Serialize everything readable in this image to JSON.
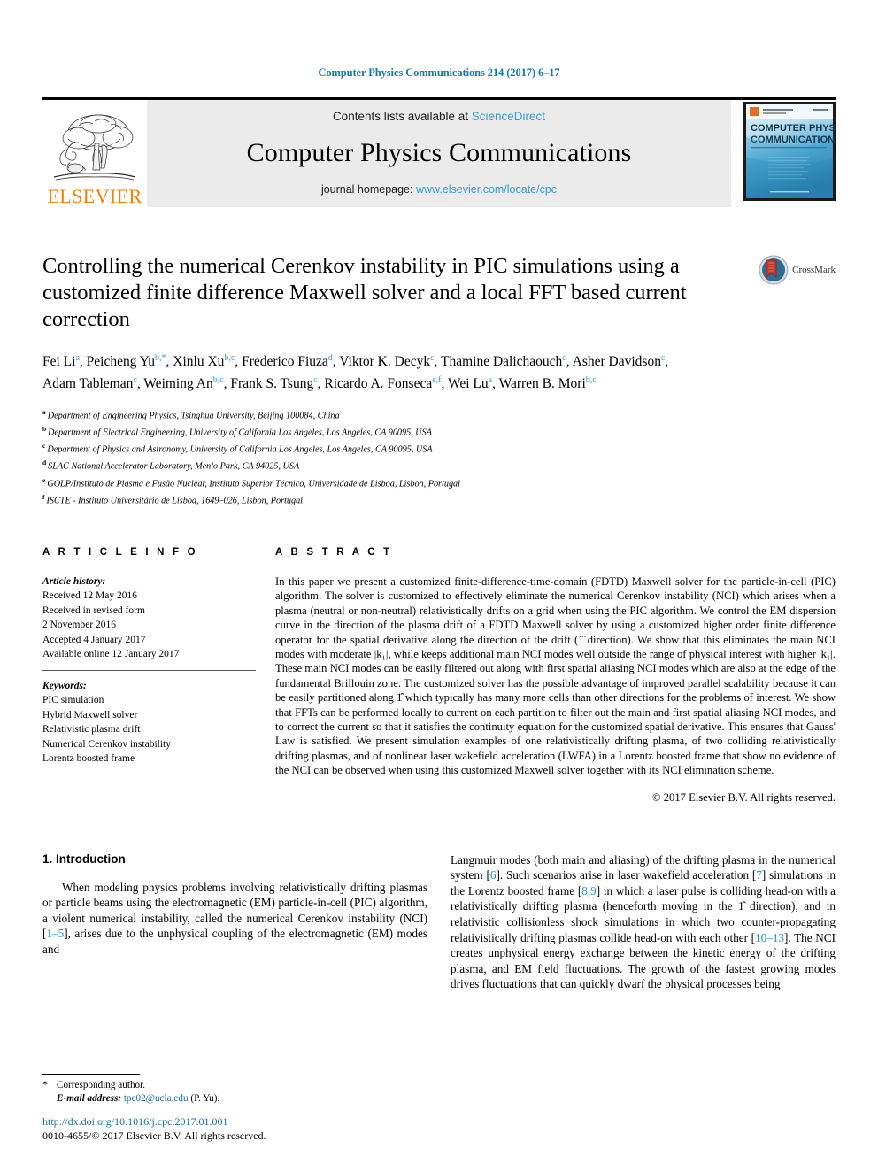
{
  "running_head": "Computer Physics Communications 214 (2017) 6–17",
  "masthead": {
    "publisher_name": "ELSEVIER",
    "contents_prefix": "Contents lists available at ",
    "contents_link": "ScienceDirect",
    "journal_title": "Computer Physics Communications",
    "homepage_prefix": "journal homepage: ",
    "homepage_url": "www.elsevier.com/locate/cpc",
    "cover_line1": "COMPUTER PHYSICS",
    "cover_line2": "COMMUNICATIONS"
  },
  "article": {
    "title": "Controlling the numerical Cerenkov instability in PIC simulations using a customized finite difference Maxwell solver and a local FFT based current correction",
    "crossmark_label": "CrossMark",
    "authors_html": "Fei Li<sup>a</sup>, Peicheng Yu<sup>b,*</sup>, Xinlu Xu<sup>b,c</sup>, Frederico Fiuza<sup>d</sup>, Viktor K. Decyk<sup>c</sup>, Thamine Dalichaouch<sup>c</sup>, Asher Davidson<sup>c</sup>, Adam Tableman<sup>c</sup>, Weiming An<sup>b,c</sup>, Frank S. Tsung<sup>c</sup>, Ricardo A. Fonseca<sup>e,f</sup>, Wei Lu<sup>a</sup>, Warren B. Mori<sup>b,c</sup>",
    "affiliations": [
      {
        "mark": "a",
        "text": "Department of Engineering Physics, Tsinghua University, Beijing 100084, China"
      },
      {
        "mark": "b",
        "text": "Department of Electrical Engineering, University of California Los Angeles, Los Angeles, CA 90095, USA"
      },
      {
        "mark": "c",
        "text": "Department of Physics and Astronomy, University of California Los Angeles, Los Angeles, CA 90095, USA"
      },
      {
        "mark": "d",
        "text": "SLAC National Accelerator Laboratory, Menlo Park, CA 94025, USA"
      },
      {
        "mark": "e",
        "text": "GOLP/Instituto de Plasma e Fusão Nuclear, Instituto Superior Técnico, Universidade de Lisboa, Lisbon, Portugal"
      },
      {
        "mark": "f",
        "text": "ISCTE - Instituto Universitário de Lisboa, 1649–026, Lisbon, Portugal"
      }
    ]
  },
  "article_info": {
    "heading": "A R T I C L E   I N F O",
    "history_label": "Article history:",
    "history": [
      "Received 12 May 2016",
      "Received in revised form",
      "2 November 2016",
      "Accepted 4 January 2017",
      "Available online 12 January 2017"
    ],
    "keywords_label": "Keywords:",
    "keywords": [
      "PIC simulation",
      "Hybrid Maxwell solver",
      "Relativistic plasma drift",
      "Numerical Cerenkov instability",
      "Lorentz boosted frame"
    ]
  },
  "abstract": {
    "heading": "A B S T R A C T",
    "text": "In this paper we present a customized finite-difference-time-domain (FDTD) Maxwell solver for the particle-in-cell (PIC) algorithm. The solver is customized to effectively eliminate the numerical Cerenkov instability (NCI) which arises when a plasma (neutral or non-neutral) relativistically drifts on a grid when using the PIC algorithm. We control the EM dispersion curve in the direction of the plasma drift of a FDTD Maxwell solver by using a customized higher order finite difference operator for the spatial derivative along the direction of the drift (1̂ direction). We show that this eliminates the main NCI modes with moderate |k₁|, while keeps additional main NCI modes well outside the range of physical interest with higher |k₁|. These main NCI modes can be easily filtered out along with first spatial aliasing NCI modes which are also at the edge of the fundamental Brillouin zone. The customized solver has the possible advantage of improved parallel scalability because it can be easily partitioned along 1̂ which typically has many more cells than other directions for the problems of interest. We show that FFTs can be performed locally to current on each partition to filter out the main and first spatial aliasing NCI modes, and to correct the current so that it satisfies the continuity equation for the customized spatial derivative. This ensures that Gauss' Law is satisfied. We present simulation examples of one relativistically drifting plasma, of two colliding relativistically drifting plasmas, and of nonlinear laser wakefield acceleration (LWFA) in a Lorentz boosted frame that show no evidence of the NCI can be observed when using this customized Maxwell solver together with its NCI elimination scheme.",
    "copyright": "© 2017 Elsevier B.V. All rights reserved."
  },
  "introduction": {
    "heading": "1. Introduction",
    "left_paragraph_html": "When modeling physics problems involving relativistically drifting plasmas or particle beams using the electromagnetic (EM) particle-in-cell (PIC) algorithm, a violent numerical instability, called the numerical Cerenkov instability (NCI) [<span class=\"ref\">1–5</span>], arises due to the unphysical coupling of the electromagnetic (EM) modes and",
    "right_paragraph_html": "Langmuir modes (both main and aliasing) of the drifting plasma in the numerical system [<span class=\"ref\">6</span>]. Such scenarios arise in laser wakefield acceleration [<span class=\"ref\">7</span>] simulations in the Lorentz boosted frame [<span class=\"ref\">8,9</span>] in which a laser pulse is colliding head-on with a relativistically drifting plasma (henceforth moving in the 1̂ direction), and in relativistic collisionless shock simulations in which two counter-propagating relativistically drifting plasmas collide head-on with each other [<span class=\"ref\">10–13</span>]. The NCI creates unphysical energy exchange between the kinetic energy of the drifting plasma, and EM field fluctuations. The growth of the fastest growing modes drives fluctuations that can quickly dwarf the physical processes being"
  },
  "footer": {
    "corresponding_author": "Corresponding author.",
    "email_label": "E-mail address:",
    "email": "tpc02@ucla.edu",
    "email_suffix": "(P. Yu).",
    "doi": "http://dx.doi.org/10.1016/j.cpc.2017.01.001",
    "issn_line": "0010-4655/© 2017 Elsevier B.V. All rights reserved."
  },
  "colors": {
    "link_teal": "#0e7ca8",
    "link_cyan": "#2e9fd4",
    "ref_blue": "#1a97c4",
    "elsevier_orange": "#f08000",
    "banner_gray": "#ebebeb"
  }
}
